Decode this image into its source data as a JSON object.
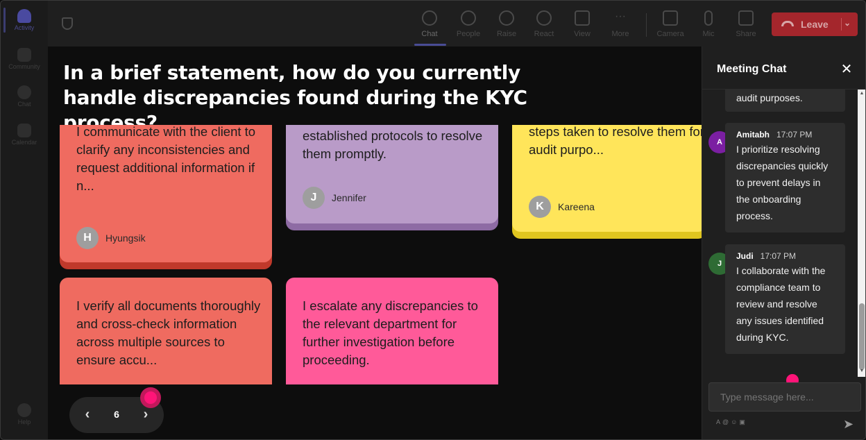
{
  "rail": {
    "items": [
      {
        "label": "Activity"
      },
      {
        "label": "Community"
      },
      {
        "label": "Chat"
      },
      {
        "label": "Calendar"
      },
      {
        "label": "Help"
      }
    ]
  },
  "toolbar": {
    "buttons": [
      {
        "label": "Chat",
        "icon": "chat-icon"
      },
      {
        "label": "People",
        "icon": "people-icon"
      },
      {
        "label": "Raise",
        "icon": "raise-hand-icon"
      },
      {
        "label": "React",
        "icon": "react-icon"
      },
      {
        "label": "View",
        "icon": "view-icon"
      },
      {
        "label": "More",
        "icon": "more-icon"
      },
      {
        "label": "Camera",
        "icon": "camera-icon"
      },
      {
        "label": "Mic",
        "icon": "mic-icon"
      },
      {
        "label": "Share",
        "icon": "share-icon"
      }
    ],
    "leave_label": "Leave"
  },
  "stage": {
    "question": "In a brief statement, how do you currently handle discrepancies found during the KYC process?",
    "cards": [
      {
        "text": "I communicate with the client to clarify any inconsistencies and request additional information if n...",
        "author": "Hyungsik",
        "initial": "H",
        "color": "#ef6b60"
      },
      {
        "text": "established protocols to resolve them promptly.",
        "author": "Jennifer",
        "initial": "J",
        "color": "#b99bc8"
      },
      {
        "text": "steps taken to resolve them for audit purpo...",
        "author": "Kareena",
        "initial": "K",
        "color": "#ffe55a"
      },
      {
        "text": "I verify all documents thoroughly and cross-check information across multiple sources to ensure accu...",
        "color": "#ef6b60"
      },
      {
        "text": "I escalate any discrepancies to the relevant department for further investigation before proceeding.",
        "color": "#ff5a99"
      }
    ],
    "pager": {
      "page": "6",
      "prev": "‹",
      "next": "›"
    }
  },
  "chat": {
    "title": "Meeting Chat",
    "close": "✕",
    "messages": [
      {
        "text": "audit purposes."
      },
      {
        "name": "Amitabh",
        "time": "17:07 PM",
        "initial": "A",
        "avatar_color": "#7b1fa2",
        "text": "I prioritize resolving discrepancies quickly to prevent delays in the onboarding process."
      },
      {
        "name": "Judi",
        "time": "17:07 PM",
        "initial": "J",
        "avatar_color": "#2e6b34",
        "text": "I collaborate with the compliance team to review and resolve any issues identified during KYC."
      }
    ],
    "input_placeholder": "Type message here...",
    "send_icon": "send-icon"
  }
}
